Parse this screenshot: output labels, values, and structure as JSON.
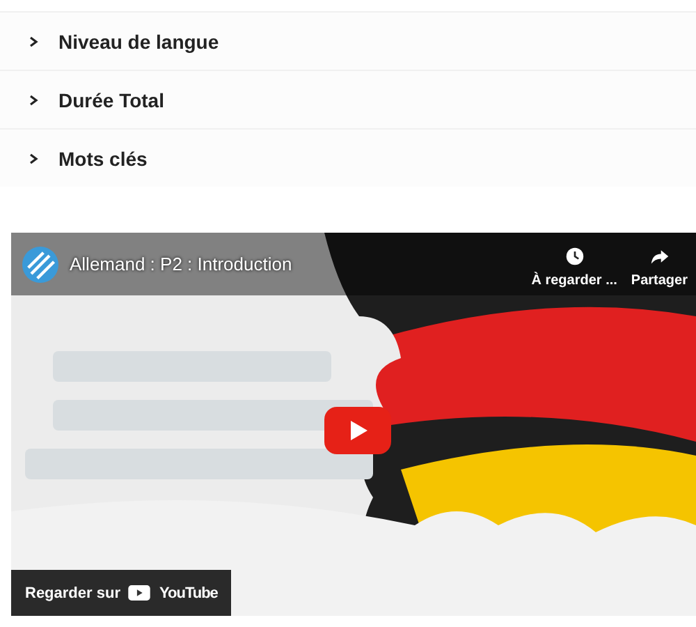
{
  "accordion": [
    {
      "label": "Niveau de langue",
      "expanded": false
    },
    {
      "label": "Durée Total",
      "expanded": false
    },
    {
      "label": "Mots clés",
      "expanded": false
    }
  ],
  "video": {
    "title": "Allemand : P2 : Introduction",
    "actions": [
      {
        "kind": "clock",
        "label": "À regarder ..."
      },
      {
        "kind": "share",
        "label": "Partager"
      }
    ],
    "watch_on": "Regarder sur",
    "watch_brand": "YouTube"
  }
}
